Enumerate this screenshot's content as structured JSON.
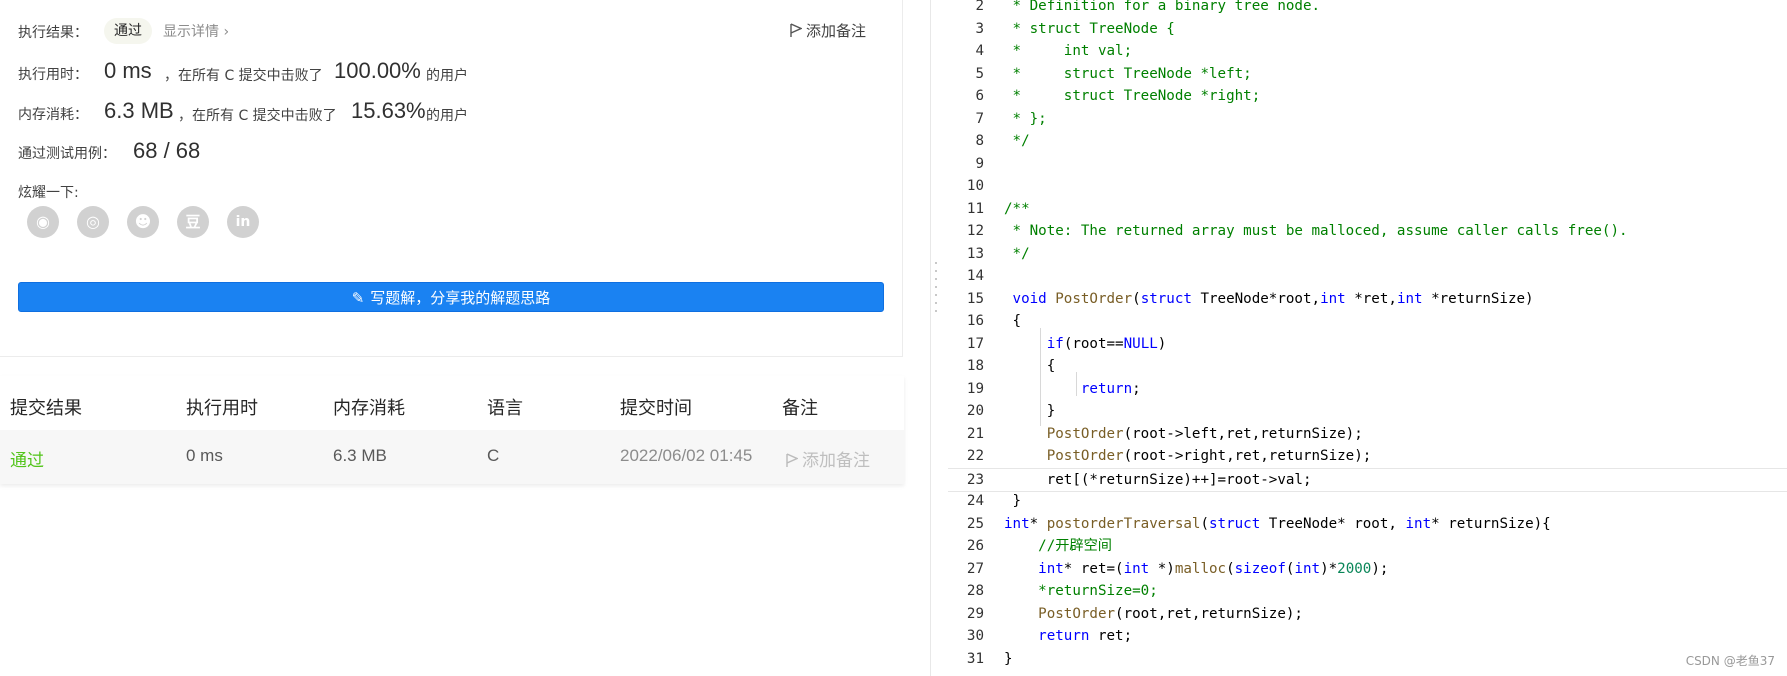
{
  "result": {
    "exec_result_label": "执行结果：",
    "status": "通过",
    "show_detail": "显示详情 ›",
    "add_note": "添加备注",
    "time_label": "执行用时：",
    "time_value": "0 ms",
    "time_mid": "，在所有 C 提交中击败了",
    "time_pct": "100.00%",
    "users": "的用户",
    "mem_label": "内存消耗：",
    "mem_value": "6.3 MB",
    "mem_mid": "，在所有 C 提交中击败了",
    "mem_pct": "15.63%",
    "tests_label": "通过测试用例：",
    "tests_value": "68 / 68",
    "share_label": "炫耀一下:",
    "share_icons": [
      "wechat-icon",
      "weibo-icon",
      "qq-icon",
      "douban-icon",
      "linkedin-icon"
    ],
    "share_glyphs": [
      "◉",
      "◎",
      "☻",
      "豆",
      "in"
    ],
    "write_button": "写题解，分享我的解题思路"
  },
  "table": {
    "headers": [
      "提交结果",
      "执行用时",
      "内存消耗",
      "语言",
      "提交时间",
      "备注"
    ],
    "row": {
      "status": "通过",
      "time": "0 ms",
      "memory": "6.3 MB",
      "language": "C",
      "submitted": "2022/06/02 01:45",
      "note": "添加备注"
    }
  },
  "colors": {
    "accent": "#1a82f2",
    "pass_green": "#52c41a"
  },
  "code": {
    "line_numbers": [
      "2",
      "3",
      "4",
      "5",
      "6",
      "7",
      "8",
      "9",
      "10",
      "11",
      "12",
      "13",
      "14",
      "15",
      "16",
      "17",
      "18",
      "19",
      "20",
      "21",
      "22",
      "23",
      "24",
      "25",
      "26",
      "27",
      "28",
      "29",
      "30",
      "31"
    ],
    "lines": [
      " * Definition for a binary tree node.",
      " * struct TreeNode {",
      " *     int val;",
      " *     struct TreeNode *left;",
      " *     struct TreeNode *right;",
      " * };",
      " */",
      "",
      "",
      "/**",
      " * Note: The returned array must be malloced, assume caller calls free().",
      " */",
      "",
      " void PostOrder(struct TreeNode*root,int *ret,int *returnSize)",
      " {",
      "     if(root==NULL)",
      "     {",
      "         return;",
      "     }",
      "     PostOrder(root->left,ret,returnSize);",
      "     PostOrder(root->right,ret,returnSize);",
      "     ret[(*returnSize)++]=root->val;",
      " }",
      "int* postorderTraversal(struct TreeNode* root, int* returnSize){",
      "    //开辟空间",
      "    int* ret=(int *)malloc(sizeof(int)*2000);",
      "    *returnSize=0;",
      "    PostOrder(root,ret,returnSize);",
      "    return ret;",
      "}"
    ]
  },
  "watermark": "CSDN @老鱼37"
}
